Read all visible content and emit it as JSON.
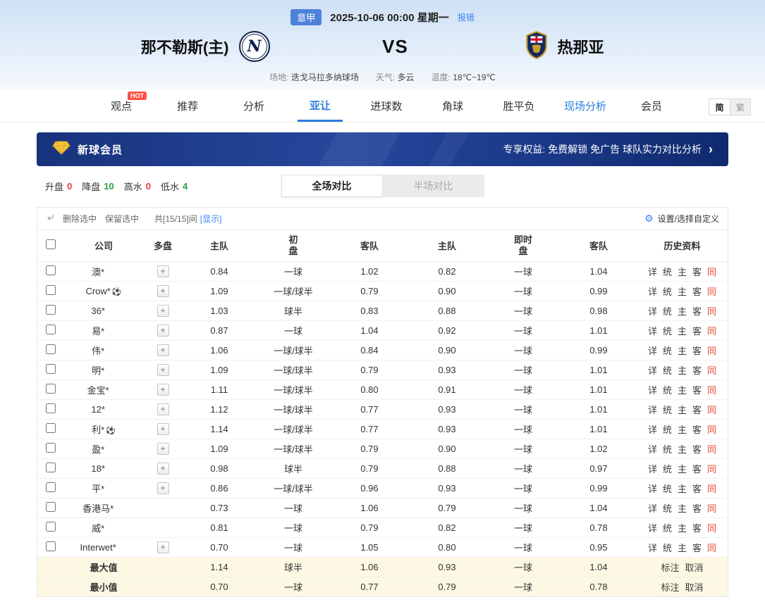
{
  "header": {
    "league": "意甲",
    "datetime": "2025-10-06 00:00 星期一",
    "report_error": "报错",
    "home_team": "那不勒斯(主)",
    "home_logo_letter": "N",
    "vs": "VS",
    "away_team": "热那亚",
    "info": [
      {
        "label": "场地:",
        "value": "迭戈马拉多纳球场"
      },
      {
        "label": "天气:",
        "value": "多云"
      },
      {
        "label": "温度:",
        "value": "18℃~19℃"
      }
    ]
  },
  "nav": {
    "items": [
      {
        "label": "观点"
      },
      {
        "label": "推荐"
      },
      {
        "label": "分析"
      },
      {
        "label": "亚让"
      },
      {
        "label": "进球数"
      },
      {
        "label": "角球"
      },
      {
        "label": "胜平负"
      },
      {
        "label": "现场分析"
      },
      {
        "label": "会员"
      }
    ],
    "hot_badge": "HOT",
    "lang": {
      "simplified": "简",
      "traditional": "繁"
    }
  },
  "banner": {
    "title": "新球会员",
    "benefits": "专享权益: 免费解锁 免广告 球队实力对比分析",
    "arrow": "›"
  },
  "filters": {
    "stats": [
      {
        "label": "升盘",
        "value": "0",
        "tone": "red"
      },
      {
        "label": "降盘",
        "value": "10",
        "tone": "green"
      },
      {
        "label": "高水",
        "value": "0",
        "tone": "red"
      },
      {
        "label": "低水",
        "value": "4",
        "tone": "green"
      }
    ],
    "tabs": {
      "full": "全场对比",
      "half": "半场对比"
    }
  },
  "toolbar": {
    "delete_selected": "删除选中",
    "keep_selected": "保留选中",
    "count": "共[15/15]间",
    "show": "[显示]",
    "settings": "设置/选择自定义"
  },
  "table": {
    "headers": {
      "company": "公司",
      "multi": "多盘",
      "home": "主队",
      "away": "客队",
      "initial": "初",
      "live": "即时",
      "handicap": "盘",
      "history": "历史资料"
    },
    "history_links": {
      "detail": "详",
      "stat": "统",
      "home": "主",
      "away": "客",
      "same": "同"
    },
    "ball_icon": "⚽",
    "plus": "+",
    "rows": [
      {
        "company": "澳*",
        "ball": false,
        "multi": true,
        "init_home": "0.84",
        "init_line": "一球",
        "init_away": "1.02",
        "live_home": "0.82",
        "live_line": "一球",
        "live_away": "1.04"
      },
      {
        "company": "Crow*",
        "ball": true,
        "multi": true,
        "init_home": "1.09",
        "init_line": "一球/球半",
        "init_away": "0.79",
        "live_home": "0.90",
        "live_line": "一球",
        "live_away": "0.99"
      },
      {
        "company": "36*",
        "ball": false,
        "multi": true,
        "init_home": "1.03",
        "init_line": "球半",
        "init_away": "0.83",
        "live_home": "0.88",
        "live_line": "一球",
        "live_away": "0.98"
      },
      {
        "company": "易*",
        "ball": false,
        "multi": true,
        "init_home": "0.87",
        "init_line": "一球",
        "init_away": "1.04",
        "live_home": "0.92",
        "live_line": "一球",
        "live_away": "1.01"
      },
      {
        "company": "伟*",
        "ball": false,
        "multi": true,
        "init_home": "1.06",
        "init_line": "一球/球半",
        "init_away": "0.84",
        "live_home": "0.90",
        "live_line": "一球",
        "live_away": "0.99"
      },
      {
        "company": "明*",
        "ball": false,
        "multi": true,
        "init_home": "1.09",
        "init_line": "一球/球半",
        "init_away": "0.79",
        "live_home": "0.93",
        "live_line": "一球",
        "live_away": "1.01"
      },
      {
        "company": "金宝*",
        "ball": false,
        "multi": true,
        "init_home": "1.11",
        "init_line": "一球/球半",
        "init_away": "0.80",
        "live_home": "0.91",
        "live_line": "一球",
        "live_away": "1.01"
      },
      {
        "company": "12*",
        "ball": false,
        "multi": true,
        "init_home": "1.12",
        "init_line": "一球/球半",
        "init_away": "0.77",
        "live_home": "0.93",
        "live_line": "一球",
        "live_away": "1.01"
      },
      {
        "company": "利*",
        "ball": true,
        "multi": true,
        "init_home": "1.14",
        "init_line": "一球/球半",
        "init_away": "0.77",
        "live_home": "0.93",
        "live_line": "一球",
        "live_away": "1.01"
      },
      {
        "company": "盈*",
        "ball": false,
        "multi": true,
        "init_home": "1.09",
        "init_line": "一球/球半",
        "init_away": "0.79",
        "live_home": "0.90",
        "live_line": "一球",
        "live_away": "1.02"
      },
      {
        "company": "18*",
        "ball": false,
        "multi": true,
        "init_home": "0.98",
        "init_line": "球半",
        "init_away": "0.79",
        "live_home": "0.88",
        "live_line": "一球",
        "live_away": "0.97"
      },
      {
        "company": "平*",
        "ball": false,
        "multi": true,
        "init_home": "0.86",
        "init_line": "一球/球半",
        "init_away": "0.96",
        "live_home": "0.93",
        "live_line": "一球",
        "live_away": "0.99"
      },
      {
        "company": "香港马*",
        "ball": false,
        "multi": false,
        "init_home": "0.73",
        "init_line": "一球",
        "init_away": "1.06",
        "live_home": "0.79",
        "live_line": "一球",
        "live_away": "1.04"
      },
      {
        "company": "威*",
        "ball": false,
        "multi": false,
        "init_home": "0.81",
        "init_line": "一球",
        "init_away": "0.79",
        "live_home": "0.82",
        "live_line": "一球",
        "live_away": "0.78"
      },
      {
        "company": "Interwet*",
        "ball": false,
        "multi": true,
        "init_home": "0.70",
        "init_line": "一球",
        "init_away": "1.05",
        "live_home": "0.80",
        "live_line": "一球",
        "live_away": "0.95"
      }
    ],
    "summary_links": {
      "mark": "标注",
      "cancel": "取消"
    },
    "summary": [
      {
        "label": "最大值",
        "init_home": "1.14",
        "init_line": "球半",
        "init_away": "1.06",
        "live_home": "0.93",
        "live_line": "一球",
        "live_away": "1.04"
      },
      {
        "label": "最小值",
        "init_home": "0.70",
        "init_line": "一球",
        "init_away": "0.77",
        "live_home": "0.79",
        "live_line": "一球",
        "live_away": "0.78"
      }
    ]
  }
}
